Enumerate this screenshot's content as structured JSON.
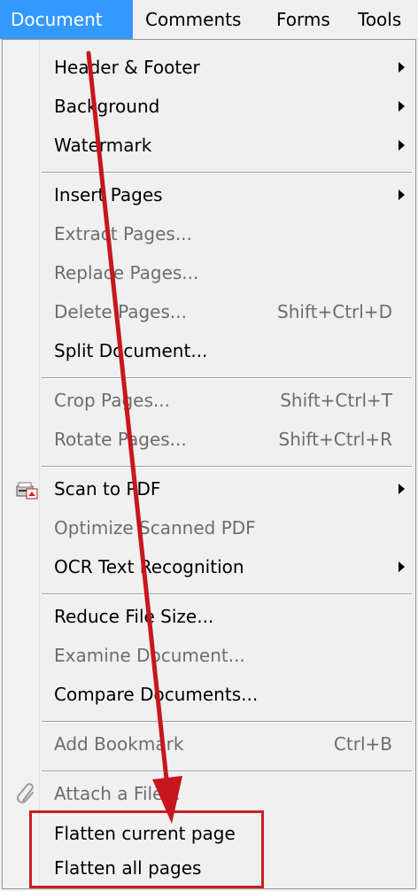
{
  "menubar": {
    "items": [
      "Document",
      "Comments",
      "Forms",
      "Tools"
    ],
    "active": "Document"
  },
  "menu": {
    "items": [
      {
        "label": "Header & Footer",
        "submenu": true,
        "enabled": true
      },
      {
        "label": "Background",
        "submenu": true,
        "enabled": true
      },
      {
        "label": "Watermark",
        "submenu": true,
        "enabled": true
      },
      {
        "label": "Insert Pages",
        "submenu": true,
        "enabled": true
      },
      {
        "label": "Extract Pages...",
        "enabled": false
      },
      {
        "label": "Replace Pages...",
        "enabled": false
      },
      {
        "label": "Delete Pages...",
        "shortcut": "Shift+Ctrl+D",
        "enabled": false
      },
      {
        "label": "Split Document...",
        "enabled": true
      },
      {
        "label": "Crop Pages...",
        "shortcut": "Shift+Ctrl+T",
        "enabled": false
      },
      {
        "label": "Rotate Pages...",
        "shortcut": "Shift+Ctrl+R",
        "enabled": false
      },
      {
        "label": "Scan to PDF",
        "submenu": true,
        "enabled": true,
        "icon": "scanner-icon"
      },
      {
        "label": "Optimize Scanned PDF",
        "enabled": false
      },
      {
        "label": "OCR Text Recognition",
        "submenu": true,
        "enabled": true
      },
      {
        "label": "Reduce File Size...",
        "enabled": true
      },
      {
        "label": "Examine Document...",
        "enabled": false
      },
      {
        "label": "Compare Documents...",
        "enabled": true
      },
      {
        "label": "Add Bookmark",
        "shortcut": "Ctrl+B",
        "enabled": false
      },
      {
        "label": "Attach a File...",
        "enabled": false,
        "icon": "paperclip-icon"
      },
      {
        "label": "Flatten current page",
        "enabled": true
      },
      {
        "label": "Flatten all pages",
        "enabled": true
      }
    ]
  },
  "annotation": {
    "arrow_color": "#c8161d",
    "highlight_color": "#c81e25",
    "highlighted_items": [
      "Flatten current page",
      "Flatten all pages"
    ]
  }
}
